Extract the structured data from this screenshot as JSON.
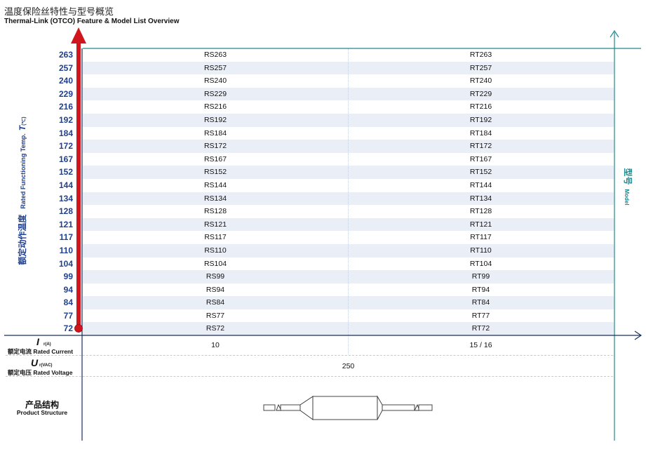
{
  "title": {
    "cn": "温度保险丝特性与型号概览",
    "en": "Thermal-Link (OTCO) Feature & Model List Overview"
  },
  "y_axis": {
    "label_cn": "额定动作温度",
    "label_en": "Rated Functioning Temp.",
    "symbol": "T",
    "unit": "(℃)"
  },
  "model_axis": {
    "label_cn": "型号",
    "label_en": "Model"
  },
  "rows": [
    {
      "temp": "263",
      "rs": "RS263",
      "rt": "RT263"
    },
    {
      "temp": "257",
      "rs": "RS257",
      "rt": "RT257"
    },
    {
      "temp": "240",
      "rs": "RS240",
      "rt": "RT240"
    },
    {
      "temp": "229",
      "rs": "RS229",
      "rt": "RT229"
    },
    {
      "temp": "216",
      "rs": "RS216",
      "rt": "RT216"
    },
    {
      "temp": "192",
      "rs": "RS192",
      "rt": "RT192"
    },
    {
      "temp": "184",
      "rs": "RS184",
      "rt": "RT184"
    },
    {
      "temp": "172",
      "rs": "RS172",
      "rt": "RT172"
    },
    {
      "temp": "167",
      "rs": "RS167",
      "rt": "RT167"
    },
    {
      "temp": "152",
      "rs": "RS152",
      "rt": "RT152"
    },
    {
      "temp": "144",
      "rs": "RS144",
      "rt": "RT144"
    },
    {
      "temp": "134",
      "rs": "RS134",
      "rt": "RT134"
    },
    {
      "temp": "128",
      "rs": "RS128",
      "rt": "RT128"
    },
    {
      "temp": "121",
      "rs": "RS121",
      "rt": "RT121"
    },
    {
      "temp": "117",
      "rs": "RS117",
      "rt": "RT117"
    },
    {
      "temp": "110",
      "rs": "RS110",
      "rt": "RT110"
    },
    {
      "temp": "104",
      "rs": "RS104",
      "rt": "RT104"
    },
    {
      "temp": "99",
      "rs": "RS99",
      "rt": "RT99"
    },
    {
      "temp": "94",
      "rs": "RS94",
      "rt": "RT94"
    },
    {
      "temp": "84",
      "rs": "RS84",
      "rt": "RT84"
    },
    {
      "temp": "77",
      "rs": "RS77",
      "rt": "RT77"
    },
    {
      "temp": "72",
      "rs": "RS72",
      "rt": "RT72"
    }
  ],
  "current": {
    "symbol": "I",
    "sub": "r(A)",
    "label_cn": "额定电流",
    "label_en": "Rated Current",
    "rs_value": "10",
    "rt_value": "15 / 16"
  },
  "voltage": {
    "symbol": "U",
    "sub": "r(VAC)",
    "label_cn": "额定电压",
    "label_en": "Rated Voltage",
    "value": "250"
  },
  "product_structure": {
    "label_cn": "产品结构",
    "label_en": "Product Structure"
  },
  "colors": {
    "axis_navy": "#1a2f5a",
    "axis_teal": "#1e8a8f",
    "arrow_red": "#d0161c",
    "row_shade": "#eaeff7",
    "temp_blue": "#1f3f8f"
  }
}
